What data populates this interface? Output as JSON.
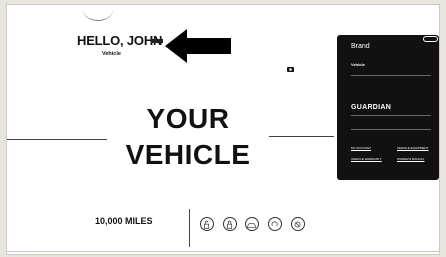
{
  "greeting": {
    "text": "HELLO, JOHN",
    "badge": "",
    "vehicle_link": "Vehicle",
    "vehicle_sub": ""
  },
  "hero": {
    "line1": "YOUR",
    "line2": "VEHICLE"
  },
  "brand_panel": {
    "close_label": "",
    "title": "Brand",
    "vehicle": "Vehicle",
    "services_label": "",
    "service_status": "",
    "logo_text": "GUARDIAN",
    "mileage_label": "",
    "mileage_text": "",
    "quick_links_label": "",
    "links": [
      "MY ACCOUNT",
      "VEHICLE EQUIPMENT",
      "VEHICLE WARRANTY",
      "OWNER'S MANUAL"
    ]
  },
  "maintenance": {
    "label": "",
    "value": "10,000 MILES"
  },
  "commands": {
    "title": "",
    "buttons": [
      {
        "label": "",
        "icon": "unlock-icon"
      },
      {
        "label": "",
        "icon": "lock-icon"
      },
      {
        "label": "",
        "icon": "car-icon"
      },
      {
        "label": "",
        "icon": "horn-icon"
      },
      {
        "label": "",
        "icon": "cancel-icon"
      }
    ]
  },
  "colors": {
    "panel_bg": "#111111",
    "page_bg": "#ffffff",
    "outer_bg": "#e8e4de",
    "accent": "#000000"
  }
}
